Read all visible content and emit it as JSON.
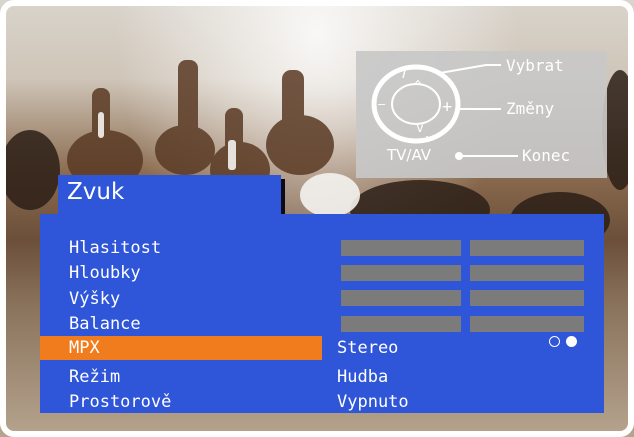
{
  "remote": {
    "select_label": "Vybrat",
    "change_label": "Změny",
    "exit_label": "Konec",
    "tvav_label": "TV/AV",
    "up_glyph": "^",
    "down_glyph": "v",
    "minus_glyph": "—",
    "plus_glyph": "+"
  },
  "menu": {
    "title": "Zvuk",
    "items": [
      {
        "label": "Hlasitost",
        "value": "",
        "bar_fraction": 1.0
      },
      {
        "label": "Hloubky",
        "value": "",
        "bar_fraction": 1.0
      },
      {
        "label": "Výšky",
        "value": "",
        "bar_fraction": 1.0
      },
      {
        "label": "Balance",
        "value": "",
        "bar_fraction": 1.0
      },
      {
        "label": "MPX",
        "value": "Stereo",
        "selected": true
      },
      {
        "label": "Režim",
        "value": "Hudba"
      },
      {
        "label": "Prostorově",
        "value": "Vypnuto"
      }
    ]
  },
  "colors": {
    "panel": "#2f55d8",
    "selected": "#f07c1d",
    "bar": "#7b7b7b",
    "text": "#ffffff",
    "overlay": "#c8c8c8"
  }
}
